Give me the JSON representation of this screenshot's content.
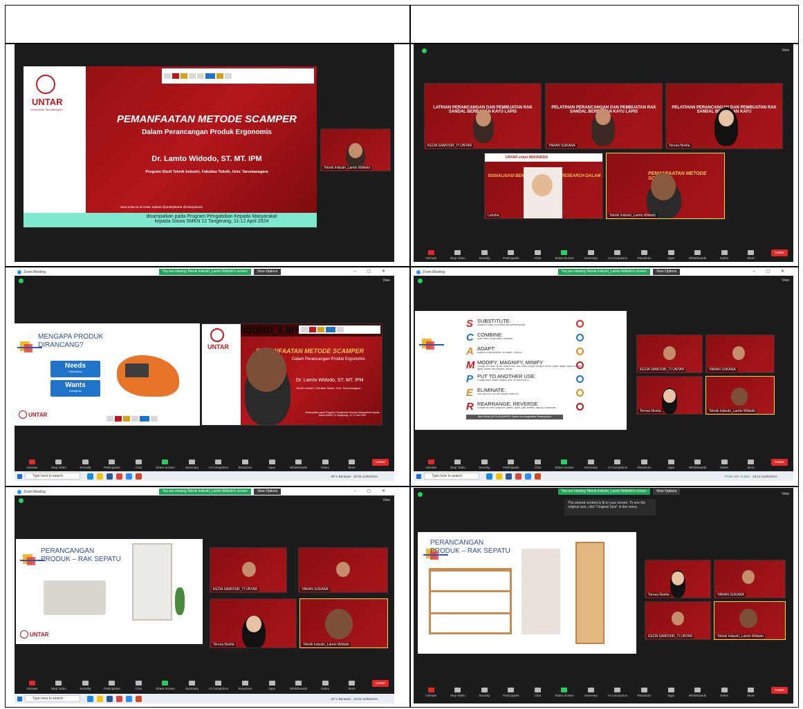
{
  "cell1": {
    "title": "PEMANFAATAN METODE SCAMPER",
    "subtitle": "Dalam Perancangan Produk Ergonomis",
    "speaker": "Dr. Lamto Widodo, ST. MT. IPM",
    "program": "Program Studi Teknik Industri, Fakultas Teknik, Univ. Tarumanagara",
    "socials": "www.untar.ac.id   Untar Jakarta   @untarjakarta   @untarjakarta",
    "footer_line1": "disampaikan pada Program Pengabdian Kepada Masyarakat",
    "footer_line2": "kepada Siswa SMKN 12 Tangerang, 11-12 April 2024",
    "untar": "UNTAR",
    "untar_sub": "Universitas Tarumanagara",
    "pip_name": "Teknik Industri_Lamto Widodo"
  },
  "cell2": {
    "view": "View",
    "tiles": [
      {
        "name": "KEZIA SAMOSIR_TI UNTAR",
        "text": "LATIHAN PERANCANGAN DAN PEMBUATAN RAK SANDAL BERBAHAN KAYU LAPIS"
      },
      {
        "name": "YARAN SUKANA",
        "text": "PELATIHAN PERANCANGAN DAN PEMBUATAN RAK SANDAL BERBAHAN KAYU LAPIS"
      },
      {
        "name": "Teresa Novita",
        "text": "PELATIHAN PERANCANGAN DAN PEMBUATAN RAK SANDAL BERBAHAN KAYU"
      },
      {
        "name": "Larisha",
        "text": "SOSIALISASI BENCHMARKING DAN RESEARCH DALAM PRODUK"
      },
      {
        "name": "Teknik Industri_Lamto Widodo",
        "text": "PEMANFAATAN METODE SCAMPER"
      }
    ],
    "untar_indonesia": "UNTAR untuk INDONESIA"
  },
  "toolbar": {
    "items": [
      "Unmute",
      "Stop Video",
      "Security",
      "Participants",
      "Chat",
      "Share Screen",
      "Summary",
      "AI Companion",
      "Reactions",
      "Apps",
      "Whiteboards",
      "Notes",
      "More"
    ],
    "participants_count": "11",
    "leave": "Leave"
  },
  "winbar": {
    "app": "Zoom Meeting",
    "banner": "You are viewing Teknik Industri_Lamto Widodo's screen",
    "view_options": "View Options"
  },
  "taskbar": {
    "search": "Type here to search",
    "tray3": "29°C Berawan",
    "tray4": "FTSE 100 +0.63%",
    "time3": "20:08",
    "date3": "11/05/2024",
    "time4": "20:13",
    "date4": "11/05/2024",
    "time5": "20:23",
    "date5": "11/05/2024"
  },
  "cell3": {
    "title_line1": "MENGAPA PRODUK",
    "title_line2": "DIRANCANG?",
    "needs": "Needs",
    "needs_sub": "Kebutuhan",
    "wants": "Wants",
    "wants_sub": "Keinginan",
    "main_title": "PEMANFAATAN METODE SCAMPER",
    "main_sub": "Dalam Perancangan Produk Ergonomis",
    "speaker": "Dr. Lamto Widodo, ST. MT. IPM",
    "program": "Teknik Industri, Fakultas Teknik, Univ. Tarumanagara",
    "footer": "disampaikan pada Program Pengabdian Kepada Masyarakat kepada Siswa SMKN 12 Tangerang, 11-12 Mei 2024",
    "pip_name": "Teknik Industri_Lamto Widodo",
    "untar": "UNTAR"
  },
  "cell4": {
    "scamper": [
      {
        "letter": "S",
        "head": "SUBSTITUTE:",
        "desc": "Replace a thing, or concepts with something else"
      },
      {
        "letter": "C",
        "head": "COMBINE:",
        "desc": "Unite! Merit? What ideas? Materials?"
      },
      {
        "letter": "A",
        "head": "ADAPT:",
        "desc": "Adjust to a new purpose. Re-shape? Tone-up?"
      },
      {
        "letter": "M",
        "head": "MODIFY, MAGNIFY, MINIFY",
        "desc": "Change the colour, sound, motion form, size. Make it larger stronger, thicker, higher, longer. Make it smaller, lighter, slower, less frequent, reduce."
      },
      {
        "letter": "P",
        "head": "PUT TO ANOTHER USE:",
        "desc": "Change when, where, location, time, or how to use it."
      },
      {
        "letter": "E",
        "head": "ELIMINATE:",
        "desc": "Omit, get rid of, cut out, simplify, weed out..."
      },
      {
        "letter": "R",
        "head": "REARRANGE, REVERSE",
        "desc": "Change the order, sequence, pattern, layout, plan, scheme, regroup, redistribute..."
      }
    ],
    "caption": "Bob Eberle (1971) SCAMPER: Games for Imagination Development",
    "tiles": [
      {
        "name": "KEZIA SAMOSIR_TI UNTAR"
      },
      {
        "name": "YARAN SUKANA"
      },
      {
        "name": "Teresa Novita"
      },
      {
        "name": "Teknik Industri_Lamto Widodo"
      }
    ]
  },
  "cell5": {
    "title_line1": "PERANCANGAN",
    "title_line2": "PRODUK – RAK SEPATU",
    "untar": "UNTAR",
    "tiles": [
      {
        "name": "KEZIA SAMOSIR_TI UNTAR"
      },
      {
        "name": "YARAN SUKANA"
      },
      {
        "name": "Teresa Novita"
      },
      {
        "name": "Teknik Industri_Lamto Widodo"
      }
    ]
  },
  "cell6": {
    "tooltip": "The shared content is fit to your screen. To see the original size, click \"Original Size\" in the menu.",
    "title_line1": "PERANCANGAN",
    "title_line2": "PRODUK – RAK SEPATU",
    "tiles": [
      {
        "name": "Teresa Novita"
      },
      {
        "name": "YARAN SUKANA"
      },
      {
        "name": "KEZIA SAMOSIR_TI UNTAR"
      },
      {
        "name": "Teknik Industri_Lamto Widodo"
      }
    ]
  }
}
